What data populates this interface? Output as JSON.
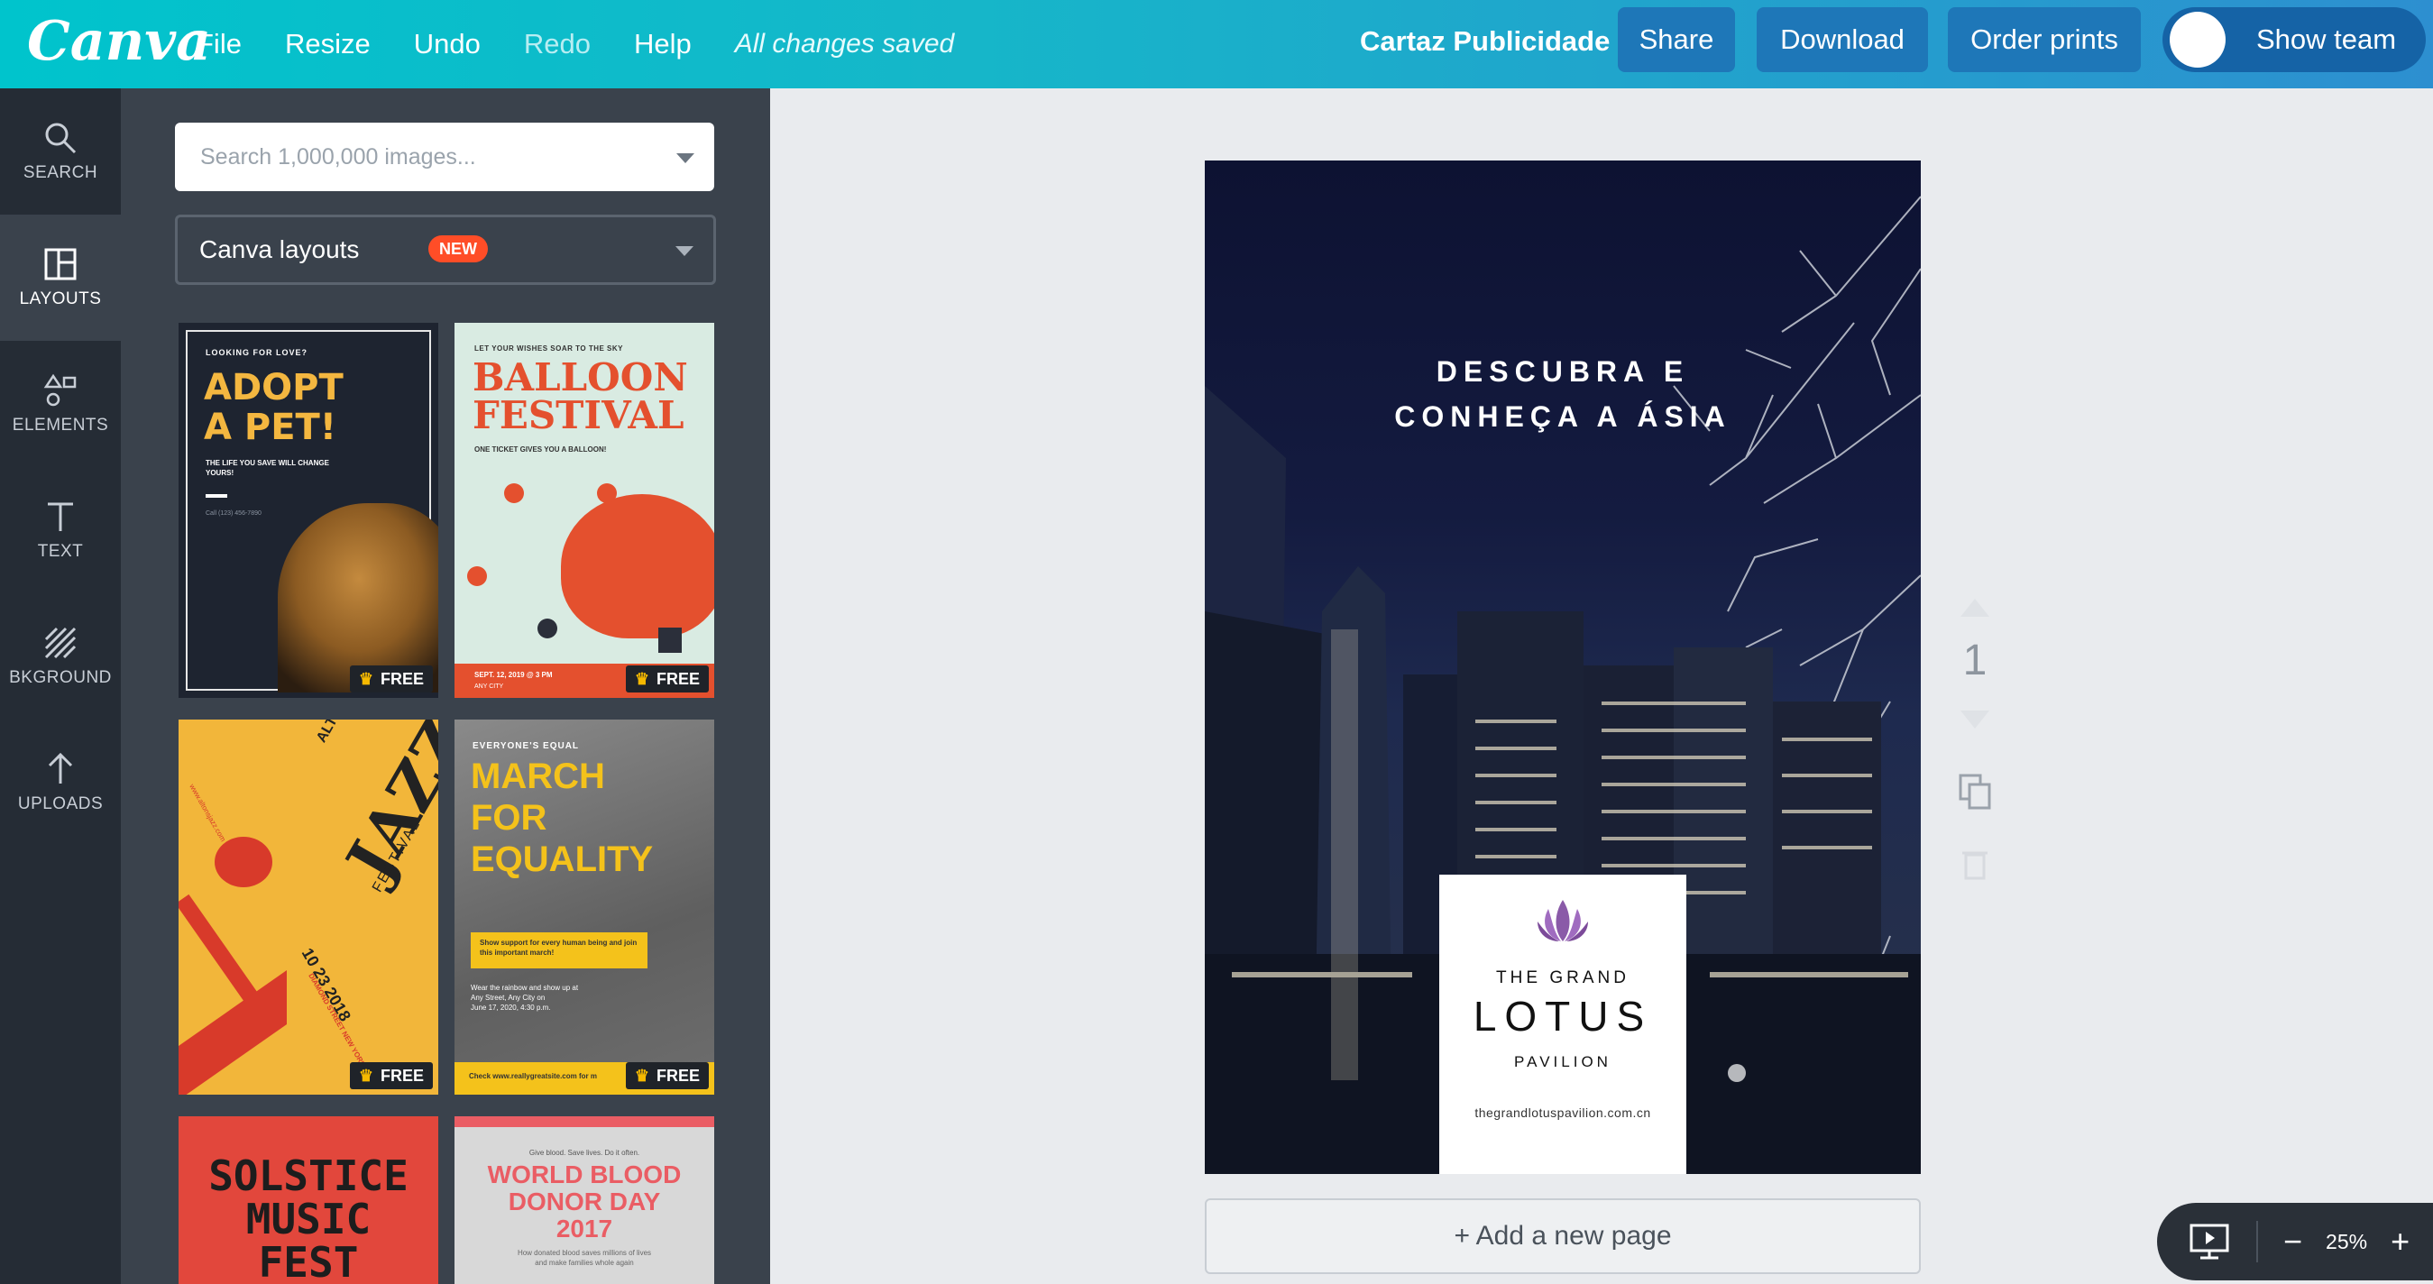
{
  "app": {
    "logo": "Canva",
    "menu": {
      "file": "File",
      "resize": "Resize",
      "undo": "Undo",
      "redo": "Redo",
      "help": "Help",
      "status": "All changes saved"
    },
    "design_title": "Cartaz Publicidade",
    "share": "Share",
    "download": "Download",
    "order_prints": "Order prints",
    "show_team": "Show team"
  },
  "rail": [
    {
      "label": "SEARCH",
      "icon": "search-icon"
    },
    {
      "label": "LAYOUTS",
      "icon": "layouts-icon",
      "active": true
    },
    {
      "label": "ELEMENTS",
      "icon": "elements-icon"
    },
    {
      "label": "TEXT",
      "icon": "text-icon"
    },
    {
      "label": "BKGROUND",
      "icon": "background-icon"
    },
    {
      "label": "UPLOADS",
      "icon": "upload-icon"
    }
  ],
  "panel": {
    "search_placeholder": "Search 1,000,000 images...",
    "layouts_label": "Canva layouts",
    "new_badge": "NEW",
    "free_label": "FREE",
    "thumbnails": {
      "pet": {
        "kicker": "LOOKING FOR LOVE?",
        "title1": "ADOPT",
        "title2": "A PET!",
        "sub": "THE LIFE YOU SAVE WILL CHANGE YOURS!",
        "phone": "Call (123) 456-7890"
      },
      "balloon": {
        "kicker": "LET YOUR WISHES SOAR TO THE SKY",
        "title1": "BALLOON",
        "title2": "FESTIVAL",
        "sub": "ONE TICKET GIVES YOU A BALLOON!",
        "footer1": "SEPT. 12, 2019 @ 3 PM",
        "footer2": "ANY CITY"
      },
      "jazz": {
        "title1": "ALTON'S",
        "title2": "JAZZ",
        "title3": "FESTIVAL",
        "date": "10 23 2018",
        "street": "DIAMOND STREET NEW YORK",
        "site": "www.altonsjazz.com"
      },
      "march": {
        "kicker": "EVERYONE'S EQUAL",
        "title1": "MARCH",
        "title2": "FOR",
        "title3": "EQUALITY",
        "box": "Show support for every human being and join this important march!",
        "details1": "Wear the rainbow and show up at",
        "details2": "Any Street, Any City on",
        "details3": "June 17, 2020, 4:30 p.m.",
        "site": "Check www.reallygreatsite.com for m"
      },
      "solstice": {
        "title1": "SOLSTICE",
        "title2": "MUSIC",
        "title3": "FEST"
      },
      "blood": {
        "kicker": "Give blood. Save lives. Do it often.",
        "title1": "WORLD BLOOD",
        "title2": "DONOR DAY",
        "title3": "2017",
        "sub1": "How donated blood saves millions of lives",
        "sub2": "and make families whole again"
      }
    }
  },
  "poster": {
    "headline1": "DESCUBRA E",
    "headline2": "CONHEÇA A ÁSIA",
    "brand_line1": "THE GRAND",
    "brand_line2": "LOTUS",
    "brand_line3": "PAVILION",
    "url": "thegrandlotuspavilion.com.cn"
  },
  "page_number": "1",
  "add_page": "+ Add a new page",
  "zoom": "25%",
  "colors": {
    "accent": "#00c4cc",
    "button": "#1e77b8",
    "badge": "#ff4d27",
    "panel": "#3a424c",
    "rail": "#252c35"
  }
}
